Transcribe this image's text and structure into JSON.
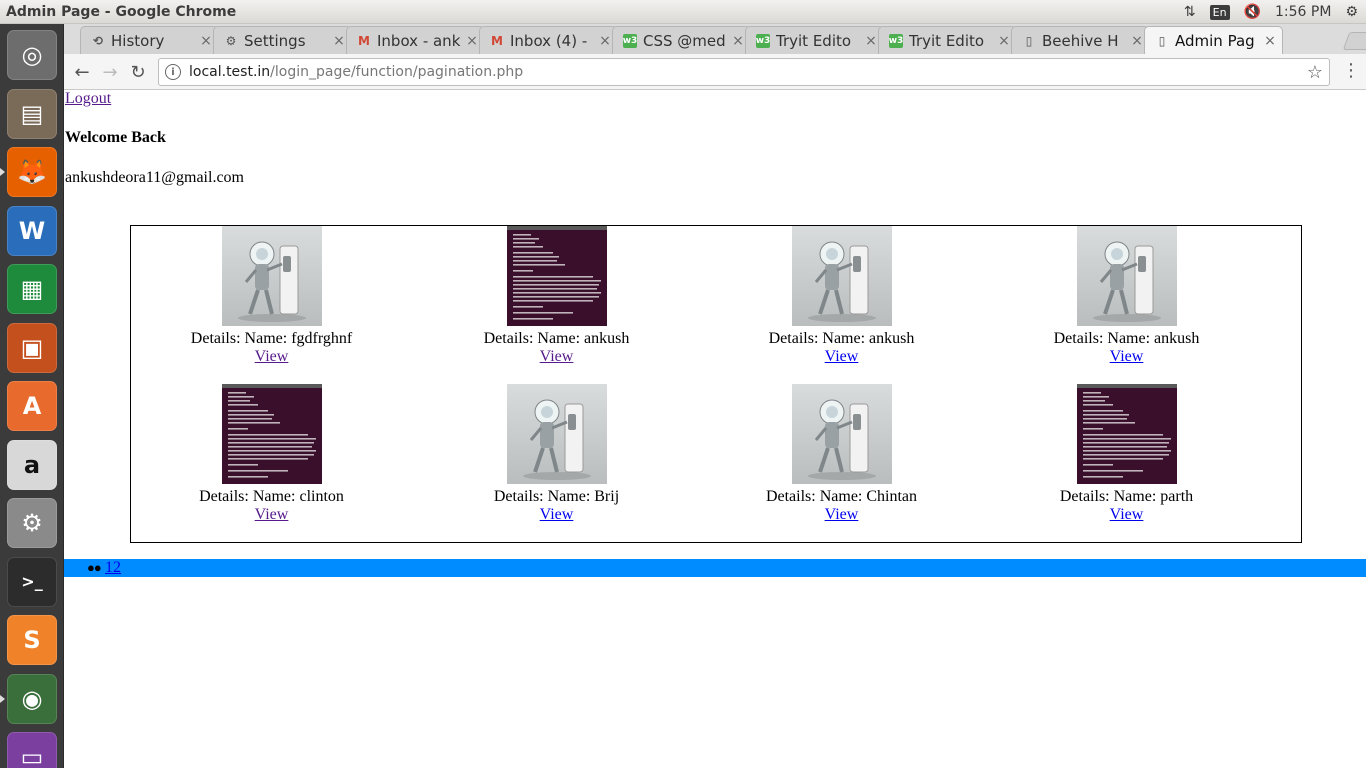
{
  "system": {
    "window_title": "Admin Page - Google Chrome",
    "clock": "1:56 PM",
    "keyboard_layout": "En"
  },
  "launcher": {
    "apps": [
      {
        "name": "ubuntu-dash",
        "color": "#6d6d6d"
      },
      {
        "name": "files",
        "color": "#7a6a58"
      },
      {
        "name": "firefox",
        "color": "#e66000"
      },
      {
        "name": "libreoffice-writer",
        "color": "#2a6ebb"
      },
      {
        "name": "libreoffice-calc",
        "color": "#1e8a3c"
      },
      {
        "name": "libreoffice-impress",
        "color": "#c4501e"
      },
      {
        "name": "ubuntu-software",
        "color": "#e86a2c"
      },
      {
        "name": "amazon",
        "color": "#d8d8d8"
      },
      {
        "name": "system-settings",
        "color": "#8a8a8a"
      },
      {
        "name": "terminal",
        "color": "#2c2c2c"
      },
      {
        "name": "sublime-text",
        "color": "#f0822a"
      },
      {
        "name": "chrome",
        "color": "#3a6e3a"
      },
      {
        "name": "workspace-switcher",
        "color": "#7b3fa0"
      }
    ]
  },
  "browser": {
    "tabs": [
      {
        "label": "History",
        "icon": "history-icon"
      },
      {
        "label": "Settings",
        "icon": "gear-icon"
      },
      {
        "label": "Inbox - ank",
        "icon": "gmail-icon"
      },
      {
        "label": "Inbox (4) -",
        "icon": "gmail-icon"
      },
      {
        "label": "CSS @med",
        "icon": "w3schools-icon"
      },
      {
        "label": "Tryit Edito",
        "icon": "w3schools-icon"
      },
      {
        "label": "Tryit Edito",
        "icon": "w3schools-icon"
      },
      {
        "label": "Beehive H",
        "icon": "page-icon"
      },
      {
        "label": "Admin Pag",
        "icon": "page-icon",
        "active": true
      }
    ],
    "url_host": "local.test.in",
    "url_path": "/login_page/function/pagination.php"
  },
  "page": {
    "logout_label": "Logout",
    "welcome_text": "Welcome Back",
    "user_email": "ankushdeora11@gmail.com",
    "cards": [
      {
        "caption": "Details: Name: fgdfrghnf",
        "view_label": "View",
        "image": "robot-image",
        "visited": true
      },
      {
        "caption": "Details: Name: ankush",
        "view_label": "View",
        "image": "terminal-screenshot-image",
        "visited": true
      },
      {
        "caption": "Details: Name: ankush",
        "view_label": "View",
        "image": "robot-image",
        "visited": false
      },
      {
        "caption": "Details: Name: ankush",
        "view_label": "View",
        "image": "robot-image",
        "visited": false
      },
      {
        "caption": "Details: Name: clinton",
        "view_label": "View",
        "image": "terminal-screenshot-image",
        "visited": true
      },
      {
        "caption": "Details: Name: Brij",
        "view_label": "View",
        "image": "robot-image",
        "visited": false
      },
      {
        "caption": "Details: Name: Chintan",
        "view_label": "View",
        "image": "robot-image",
        "visited": false
      },
      {
        "caption": "Details: Name: parth",
        "view_label": "View",
        "image": "terminal-screenshot-image",
        "visited": false
      }
    ],
    "pager_bullets": "●●",
    "pager_pages": "12",
    "pager_bar_color": "#008cff"
  }
}
